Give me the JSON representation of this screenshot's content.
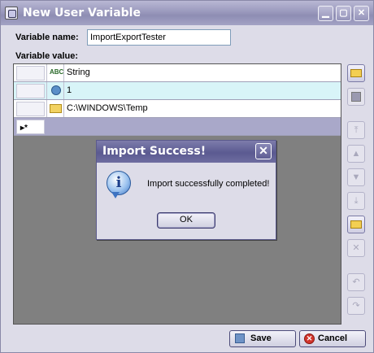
{
  "window": {
    "title": "New User Variable",
    "controls": {
      "minimize": "▁",
      "maximize": "▢",
      "close": "✕"
    }
  },
  "form": {
    "name_label": "Variable name:",
    "name_value": "ImportExportTester",
    "value_label": "Variable value:"
  },
  "grid": {
    "rows": [
      {
        "type_icon": "abc-string-icon",
        "value": "String"
      },
      {
        "type_icon": "gear-number-icon",
        "value": "1"
      },
      {
        "type_icon": "folder-path-icon",
        "value": "C:\\WINDOWS\\Temp"
      }
    ],
    "new_row_marker": "▸*"
  },
  "side_toolbar": [
    {
      "name": "open-folder-button",
      "enabled": true
    },
    {
      "name": "save-disk-button",
      "enabled": false
    },
    {
      "name": "move-top-button",
      "enabled": false
    },
    {
      "name": "move-up-button",
      "enabled": false
    },
    {
      "name": "move-down-button",
      "enabled": false
    },
    {
      "name": "move-bottom-button",
      "enabled": false
    },
    {
      "name": "import-folder-button",
      "enabled": true
    },
    {
      "name": "delete-button",
      "enabled": false
    },
    {
      "name": "undo-button",
      "enabled": false
    },
    {
      "name": "redo-button",
      "enabled": false
    }
  ],
  "dialog": {
    "title": "Import Success!",
    "message": "Import successfully completed!",
    "ok_label": "OK",
    "close_glyph": "✕",
    "info_glyph": "i"
  },
  "footer": {
    "save_label": "Save",
    "cancel_label": "Cancel"
  },
  "colors": {
    "title_bar": "#9a99bd",
    "dialog_title": "#5b5a91",
    "grid_background": "#808080",
    "selected_row": "#d8f4f8",
    "new_row": "#a9a8c9"
  }
}
